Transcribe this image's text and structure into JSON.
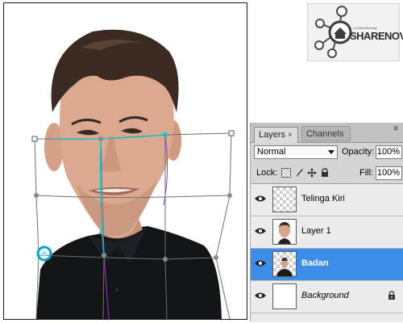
{
  "watermark": {
    "tagline": "•••Sobat Berbagi",
    "brand": "SHARENOVEL"
  },
  "layers_panel": {
    "tabs": [
      {
        "label": "Layers",
        "close": "×"
      },
      {
        "label": "Channels"
      }
    ],
    "menu_icon": "≡",
    "blend_mode": "Normal",
    "opacity_label": "Opacity:",
    "opacity_value": "100%",
    "lock_label": "Lock:",
    "fill_label": "Fill:",
    "fill_value": "100%",
    "lock_icons": [
      "lock-transparent-icon",
      "brush-icon",
      "move-icon",
      "padlock-icon"
    ],
    "layers": [
      {
        "name": "Telinga Kiri",
        "visible": true,
        "thumb": "transparent",
        "selected": false
      },
      {
        "name": "Layer 1",
        "visible": true,
        "thumb": "face",
        "selected": false
      },
      {
        "name": "Badan",
        "visible": true,
        "thumb": "body",
        "selected": true
      },
      {
        "name": "Background",
        "visible": true,
        "thumb": "white",
        "selected": false,
        "locked": true
      }
    ]
  },
  "colors": {
    "selection": "#3d8ee8",
    "panel": "#d6d6d6",
    "warp_guide": "#00c8d8"
  }
}
